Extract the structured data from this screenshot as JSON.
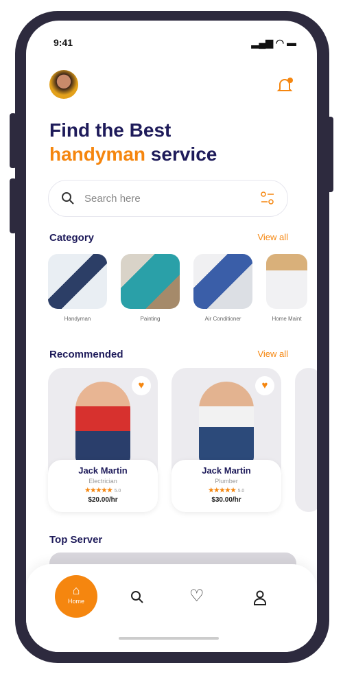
{
  "status": {
    "time": "9:41"
  },
  "header": {
    "title_line1": "Find the Best",
    "title_accent": "handyman",
    "title_rest": " service"
  },
  "search": {
    "placeholder": "Search here"
  },
  "category": {
    "title": "Category",
    "view_all": "View all",
    "items": [
      {
        "label": "Handyman"
      },
      {
        "label": "Painting"
      },
      {
        "label": "Air Conditioner"
      },
      {
        "label": "Home Maint"
      }
    ]
  },
  "recommended": {
    "title": "Recommended",
    "view_all": "View all",
    "items": [
      {
        "name": "Jack Martin",
        "role": "Electrician",
        "stars": "★★★★★",
        "rating": "5.0",
        "price": "$20.00/hr"
      },
      {
        "name": "Jack Martin",
        "role": "Plumber",
        "stars": "★★★★★",
        "rating": "5.0",
        "price": "$30.00/hr"
      }
    ]
  },
  "top_server": {
    "title": "Top Server"
  },
  "nav": {
    "home": "Home"
  },
  "colors": {
    "accent": "#f5860f",
    "primary": "#1e1b5a"
  }
}
